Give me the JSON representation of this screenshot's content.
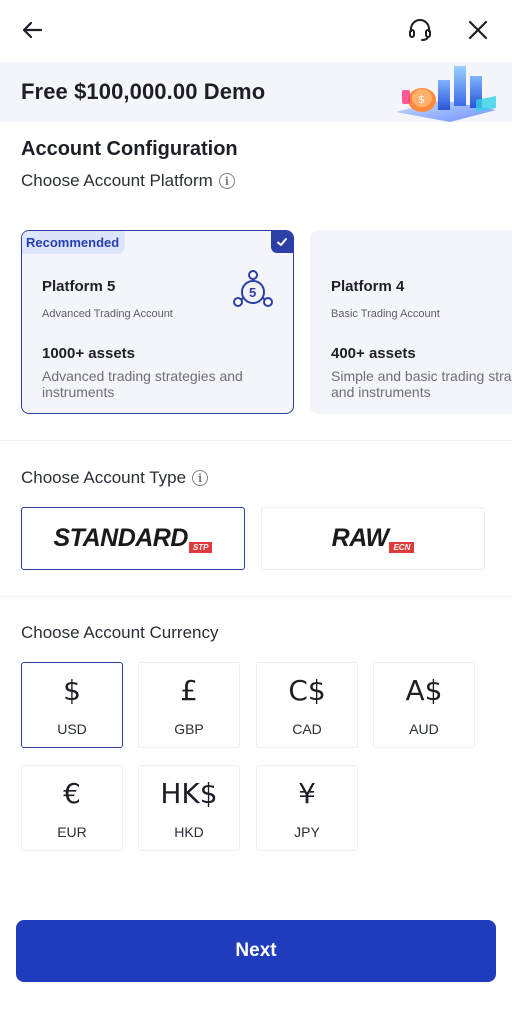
{
  "header": {
    "back_icon": "arrow-left-icon",
    "support_icon": "headset-icon",
    "close_icon": "close-icon"
  },
  "banner": {
    "title": "Free $100,000.00 Demo"
  },
  "config": {
    "title": "Account Configuration",
    "platform_label": "Choose Account Platform",
    "type_label": "Choose Account Type",
    "currency_label": "Choose Account Currency"
  },
  "platforms": [
    {
      "badge": "Recommended",
      "name": "Platform 5",
      "subtitle": "Advanced Trading Account",
      "assets": "1000+ assets",
      "desc_line1": "Advanced trading strategies and",
      "desc_line2": "instruments",
      "logo_number": "5",
      "selected": true
    },
    {
      "name": "Platform 4",
      "subtitle": "Basic Trading Account",
      "assets": "400+ assets",
      "desc_line1": "Simple and basic trading stra",
      "desc_line2": "and instruments",
      "selected": false
    }
  ],
  "account_types": [
    {
      "name": "STANDARD",
      "tag": "STP",
      "selected": true
    },
    {
      "name": "RAW",
      "tag": "ECN",
      "selected": false
    }
  ],
  "currencies": [
    {
      "symbol": "$",
      "code": "USD",
      "selected": true
    },
    {
      "symbol": "£",
      "code": "GBP",
      "selected": false
    },
    {
      "symbol": "C$",
      "code": "CAD",
      "selected": false
    },
    {
      "symbol": "A$",
      "code": "AUD",
      "selected": false
    },
    {
      "symbol": "€",
      "code": "EUR",
      "selected": false
    },
    {
      "symbol": "HK$",
      "code": "HKD",
      "selected": false
    },
    {
      "symbol": "¥",
      "code": "JPY",
      "selected": false
    }
  ],
  "next_label": "Next",
  "colors": {
    "accent": "#1f3cbd",
    "selected_border": "#2b3fa6",
    "tag_red": "#e03b3b",
    "badge_bg": "#dde5fb"
  }
}
